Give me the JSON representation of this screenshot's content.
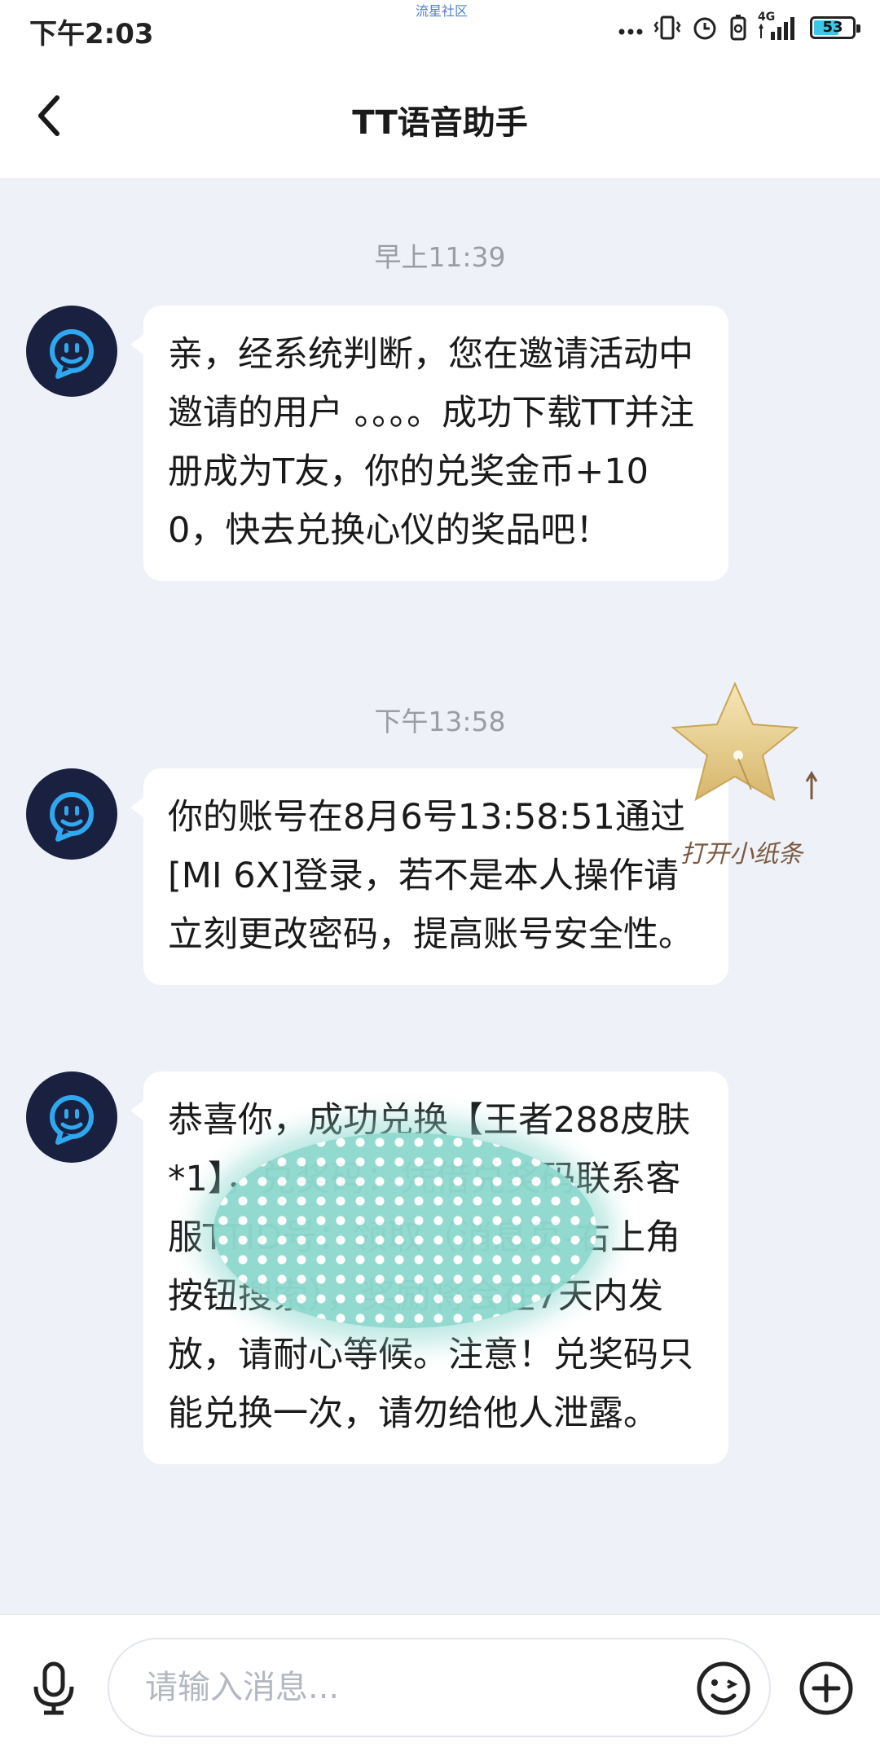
{
  "status_bar": {
    "time": "下午2:03",
    "watermark": "流星社区",
    "network": "4G",
    "battery": "53",
    "icons": [
      "dots-icon",
      "vibrate-icon",
      "alarm-icon",
      "battery-saver-icon",
      "signal-icon",
      "battery-icon"
    ]
  },
  "header": {
    "title": "TT语音助手",
    "back_icon": "chevron-left-icon"
  },
  "messages": [
    {
      "time": "早上11:39",
      "text": "亲，经系统判断，您在邀请活动中邀请的用户 。。。。成功下载TT并注册成为T友，你的兑奖金币+100，快去兑换心仪的奖品吧！"
    },
    {
      "time": "下午13:58",
      "text": "你的账号在8月6号13:58:51通过[MI 6X]登录，若不是本人操作请立刻更改密码，提高账号安全性。"
    },
    {
      "time": "",
      "text": "恭喜你，成功兑换【王者288皮肤*1】，兑奖码：凭借兑奖码联系客服TTID号：领取（消息页-右上角按钮搜索），奖励将会在7天内发放，请耐心等候。注意！兑奖码只能兑换一次，请勿给他人泄露。"
    }
  ],
  "star_widget": {
    "caption": "打开小纸条"
  },
  "input_bar": {
    "placeholder": "请输入消息...",
    "mic_icon": "microphone-icon",
    "emoji_icon": "emoji-icon",
    "plus_icon": "plus-circle-icon"
  },
  "colors": {
    "background": "#eef1f8",
    "avatar_bg": "#1a2040",
    "avatar_accent": "#2fa8f0",
    "bubble": "#ffffff",
    "timestamp": "#9a9da6"
  }
}
